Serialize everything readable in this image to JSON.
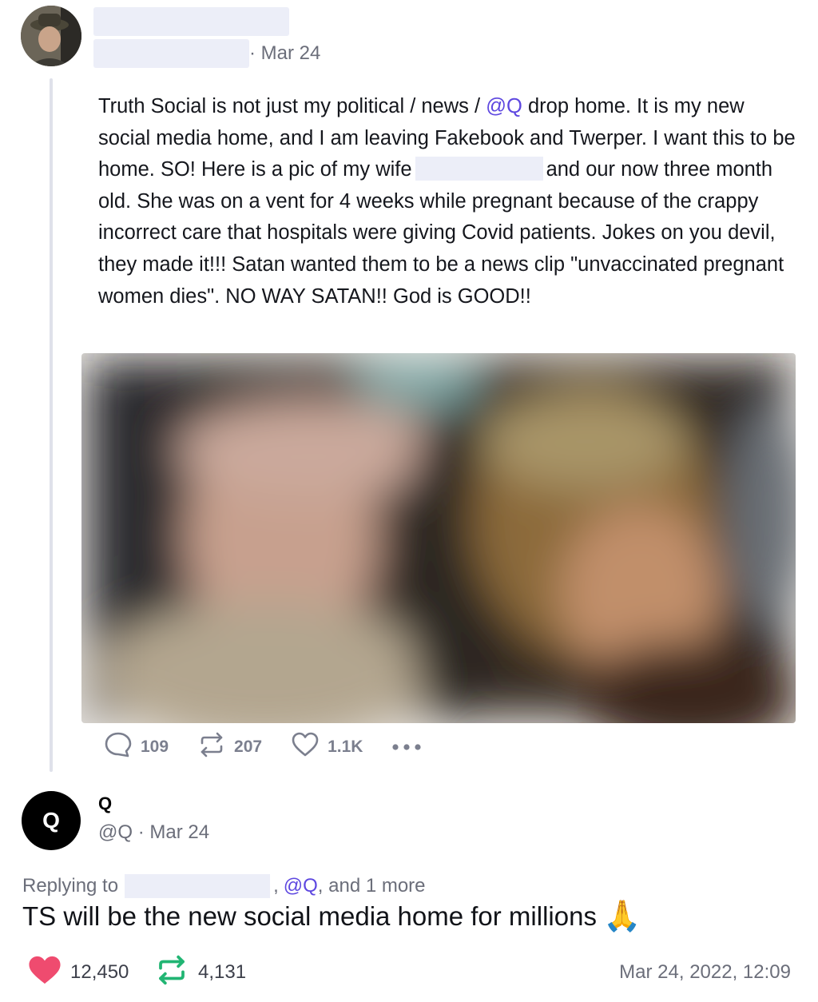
{
  "post": {
    "date": "· Mar 24",
    "text_parts": {
      "p1": "Truth Social is not just my political / news / ",
      "mention": "@Q",
      "p2": " drop home. It is my new social media home, and I am leaving Fakebook and Twerper. I want this to be home. SO! Here is a pic of my wife",
      "p3": "and our now three month old. She was on a vent for 4 weeks while pregnant because of the crappy incorrect care that hospitals were giving Covid patients. Jokes on you devil, they made it!!! Satan wanted them to be a news clip \"unvaccinated pregnant women dies\". NO WAY SATAN!! God is GOOD!!"
    },
    "actions": {
      "replies": "109",
      "retruths": "207",
      "likes": "1.1K"
    }
  },
  "reply": {
    "avatar_letter": "Q",
    "name": "Q",
    "handle_date": "@Q · Mar 24",
    "replying_prefix": "Replying to",
    "replying_comma": ",",
    "replying_mention": "@Q",
    "replying_suffix": ", and 1 more",
    "text": "TS will be the new social media home for millions",
    "emoji": "🙏",
    "likes": "12,450",
    "retruths": "4,131",
    "timestamp": "Mar 24, 2022, 12:09"
  },
  "colors": {
    "accent": "#5e48e0",
    "like": "#ef4b6f",
    "retruth": "#21b573"
  }
}
